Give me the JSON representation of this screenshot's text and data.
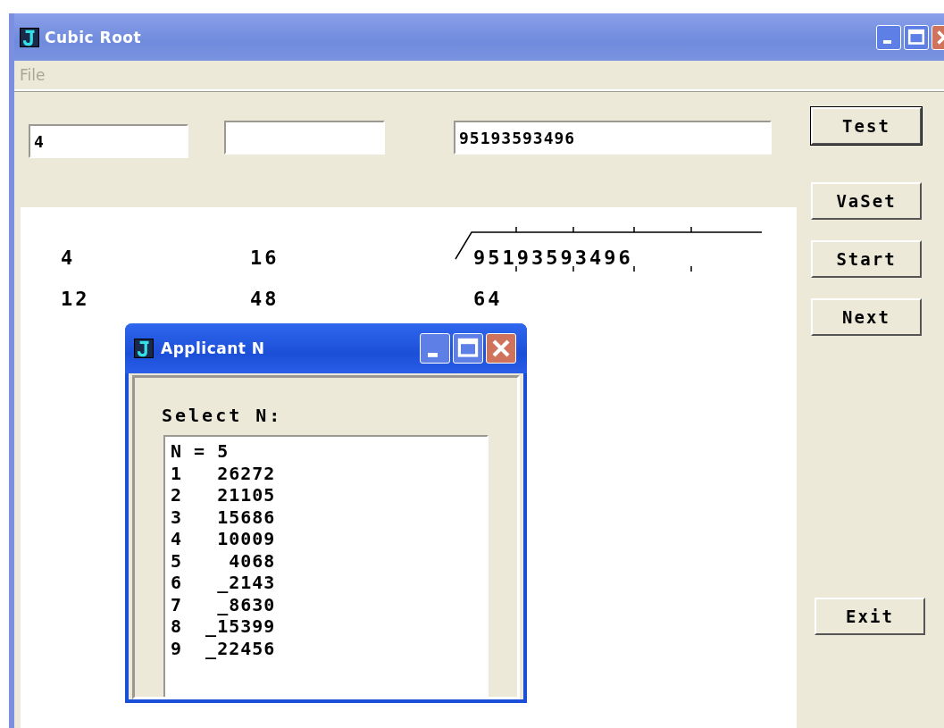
{
  "window": {
    "title": "Cubic Root"
  },
  "menu": [
    {
      "label": "File",
      "disabled": true
    }
  ],
  "fields": [
    {
      "value": "4"
    },
    {
      "value": "95193593496"
    }
  ],
  "buttons": [
    {
      "label": "Test",
      "kind": "default"
    },
    {
      "label": "VaSet",
      "kind": "normal"
    },
    {
      "label": "Start",
      "kind": "normal"
    },
    {
      "label": "Next",
      "kind": "normal"
    },
    {
      "label": "Exit",
      "kind": "normal"
    }
  ],
  "canvas": {
    "rows": [
      [
        "4",
        "16",
        "95193593496"
      ],
      [
        "12",
        "48",
        "64"
      ]
    ]
  },
  "dialog": {
    "title": "Applicant N",
    "prompt": "Select N:",
    "list": [
      "N = 5",
      "1   26272",
      "2   21105",
      "3   15686",
      "4   10009",
      "5    4068",
      "6   _2143",
      "7   _8630",
      "8  _15399",
      "9  _22456"
    ]
  }
}
